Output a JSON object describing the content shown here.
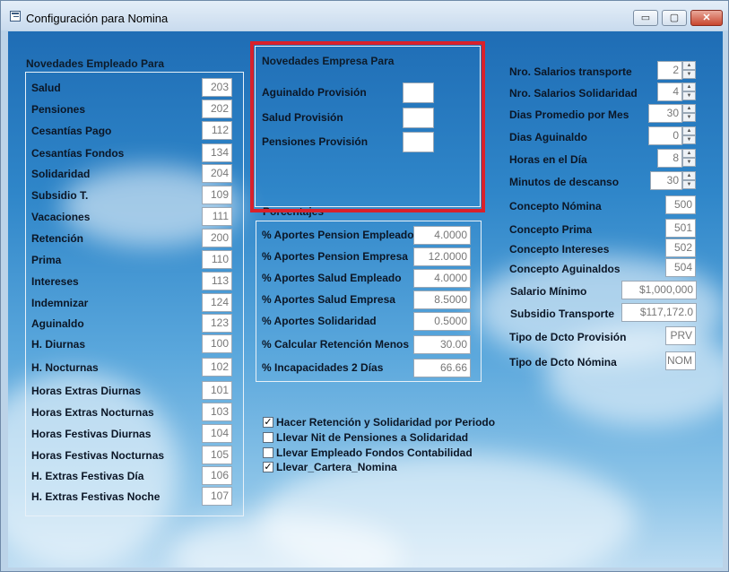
{
  "window": {
    "title": "Configuración para Nomina",
    "min_glyph": "▭",
    "max_glyph": "▢",
    "close_glyph": "✕"
  },
  "empleado": {
    "title": "Novedades Empleado Para",
    "items": [
      {
        "label": "Salud",
        "value": "203"
      },
      {
        "label": "Pensiones",
        "value": "202"
      },
      {
        "label": "Cesantías Pago",
        "value": "112"
      },
      {
        "label": "Cesantías Fondos",
        "value": "134"
      },
      {
        "label": "Solidaridad",
        "value": "204"
      },
      {
        "label": "Subsidio T.",
        "value": "109"
      },
      {
        "label": "Vacaciones",
        "value": "111"
      },
      {
        "label": "Retención",
        "value": "200"
      },
      {
        "label": "Prima",
        "value": "110"
      },
      {
        "label": "Intereses",
        "value": "113"
      },
      {
        "label": "Indemnizar",
        "value": "124"
      },
      {
        "label": "Aguinaldo",
        "value": "123"
      },
      {
        "label": "H. Diurnas",
        "value": "100"
      },
      {
        "label": "H. Nocturnas",
        "value": "102"
      },
      {
        "label": "Horas Extras Diurnas",
        "value": "101"
      },
      {
        "label": "Horas Extras Nocturnas",
        "value": "103"
      },
      {
        "label": "Horas Festivas Diurnas",
        "value": "104"
      },
      {
        "label": "Horas Festivas Nocturnas",
        "value": "105"
      },
      {
        "label": "H. Extras Festivas Día",
        "value": "106"
      },
      {
        "label": "H. Extras Festivas Noche",
        "value": "107"
      }
    ]
  },
  "empresa": {
    "title": "Novedades Empresa Para",
    "items": [
      {
        "label": "Aguinaldo Provisión",
        "value": ""
      },
      {
        "label": "Salud Provisión",
        "value": ""
      },
      {
        "label": "Pensiones Provisión",
        "value": ""
      }
    ]
  },
  "porcentajes": {
    "title": "Porcentajes",
    "items": [
      {
        "label": "% Aportes Pension Empleado",
        "value": "4.0000"
      },
      {
        "label": "% Aportes Pension Empresa",
        "value": "12.0000"
      },
      {
        "label": "% Aportes Salud Empleado",
        "value": "4.0000"
      },
      {
        "label": "% Aportes Salud Empresa",
        "value": "8.5000"
      },
      {
        "label": "% Aportes Solidaridad",
        "value": "0.5000"
      },
      {
        "label": "% Calcular Retención Menos",
        "value": "30.00"
      },
      {
        "label": "% Incapacidades 2 Días",
        "value": "66.66"
      }
    ]
  },
  "right": {
    "spinners": [
      {
        "label": "Nro. Salarios transporte",
        "value": "2"
      },
      {
        "label": "Nro. Salarios Solidaridad",
        "value": "4"
      },
      {
        "label": "Dias Promedio por Mes",
        "value": "30"
      },
      {
        "label": "Dias Aguinaldo",
        "value": "0"
      },
      {
        "label": "Horas en el Día",
        "value": "8"
      },
      {
        "label": "Minutos de descanso",
        "value": "30"
      }
    ],
    "fields": [
      {
        "label": "Concepto Nómina",
        "value": "500"
      },
      {
        "label": "Concepto Prima",
        "value": "501"
      },
      {
        "label": "Concepto Intereses",
        "value": "502"
      },
      {
        "label": "Concepto Aguinaldos",
        "value": "504"
      },
      {
        "label": "Salario Mínimo",
        "value": "$1,000,000"
      },
      {
        "label": "Subsidio Transporte",
        "value": "$117,172.0"
      },
      {
        "label": "Tipo de Dcto Provisión",
        "value": "PRV"
      },
      {
        "label": "Tipo de Dcto Nómina",
        "value": "NOM"
      }
    ]
  },
  "options": [
    {
      "label": "Hacer Retención y Solidaridad por Periodo",
      "checked": true
    },
    {
      "label": "Llevar Nit de Pensiones a Solidaridad",
      "checked": false
    },
    {
      "label": "Llevar Empleado Fondos Contabilidad",
      "checked": false
    },
    {
      "label": "Llevar_Cartera_Nomina",
      "checked": true
    }
  ],
  "colors": {
    "highlight": "#d9212b"
  }
}
